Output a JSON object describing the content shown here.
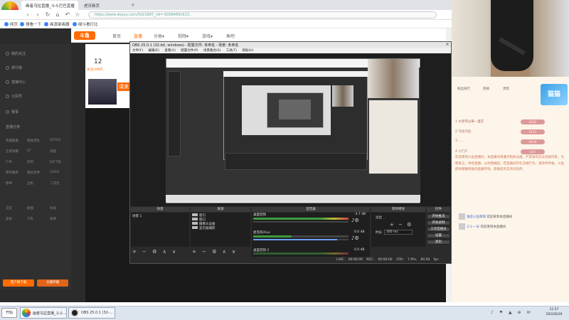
{
  "browser": {
    "tabs": [
      {
        "label": "画者乌拉直播_斗斗巴巴直播"
      },
      {
        "label": "虎牙新页",
        "active": true
      },
      {
        "label": "✕"
      }
    ],
    "new_tab": "+",
    "url": "https://www.douyu.com/5021887_rid=.60084891613..",
    "bookmarks": [
      "网页",
      "搜看一下",
      "画源录画器",
      "绿斗看打比"
    ],
    "logo_label": "巨大数据"
  },
  "douyu": {
    "logo": "斗鱼",
    "nav": [
      "首页",
      "直播",
      "分类▾",
      "视频▾",
      "游戏▾",
      "鱼吧"
    ],
    "sidebar": {
      "items": [
        "我的关注",
        "排行榜",
        "直播中心",
        "订阅号",
        "赛事"
      ],
      "section_label": "直播分类",
      "grid": [
        "英雄联盟",
        "绝地求生",
        "DOTA2",
        "王者荣耀",
        "CF",
        "穿越",
        "户外",
        "吃鸡",
        "QQ飞车",
        "和平精英",
        "我的世界",
        "CSGO",
        "原神",
        "主机",
        "二次元",
        "交友",
        "颜值",
        "科技",
        "美食",
        "汽车",
        "体育"
      ],
      "btn1": "客户端下载",
      "btn2": "主播开播"
    },
    "room": {
      "count": "12",
      "count_label": "关注小时内",
      "badge": "请来"
    }
  },
  "chat": {
    "tabs": [
      "粉丝排行",
      "周榜",
      "贵宾"
    ],
    "banner": "猫猫",
    "ranks": [
      {
        "name": "1  大佬带过来一直在",
        "tag": "LV.22"
      },
      {
        "name": "2  乌拉乌拉",
        "tag": "LV.17"
      },
      {
        "name": "3  .....",
        "tag": "LV.14"
      },
      {
        "name": "4  小门户",
        "tag": "LV.5"
      }
    ],
    "messages": "欢迎来到斗鱼直播间，本直播间请遵守相关法规，严禁发布违法违规内容，文明发言。绿色直播，从你我做起。若直播间存在违规行为，请及时举报。斗鱼倡导健康积极的直播环境，感谢您的支持与陪伴。",
    "gifts": [
      {
        "name": "谁是斗鱼萌萌",
        "text": "欢迎来到本直播间"
      },
      {
        "name": "三十一号",
        "text": "欢迎来到本直播间"
      }
    ]
  },
  "obs": {
    "title": "OBS 25.0.1 (32-bit, windows) - 配置文件: 未命名 - 场景: 未命名",
    "menu": "文件(F) 编辑(E) 查看(V) 配置文件(P) 场景集合(S) 工具(T) 帮助(H)",
    "docks": {
      "scenes": {
        "title": "场景",
        "item": "场景 1"
      },
      "sources": {
        "title": "来源",
        "items": [
          "窗口",
          "窗口",
          "摄像头设备",
          "显示器捕获"
        ]
      },
      "mixer": {
        "title": "混音器",
        "ch1": "桌面音频",
        "ch1_db": "-3.7 dB",
        "ch2": "麦克风/Aux",
        "ch2_db": "0.0 dB",
        "ch3": "桌面音频 2",
        "ch3_db": "0.0 dB"
      },
      "transitions": {
        "title": "转场特效",
        "type": "淡出",
        "duration_label": "时长",
        "duration": "300 ms"
      },
      "controls": {
        "title": "控件",
        "buttons": [
          "开始推流",
          "开始录制",
          "工作室模式",
          "设置",
          "退出"
        ]
      }
    },
    "status": {
      "live": "LIVE: 00:00:00",
      "rec": "REC: 00:00:00",
      "cpu": "CPU: 7.9%, 60.00 fps"
    },
    "controls_symbols": "+ − ⚙ ∧ ∨"
  },
  "taskbar": {
    "start": "开始",
    "apps": [
      "画者乌拉直播_斗斗...",
      "OBS 25.0.1 (32-..."
    ],
    "tray": "♪ ⚑ ▲ ⊕ ✉",
    "time": "11:57",
    "date": "2022/6/26"
  }
}
